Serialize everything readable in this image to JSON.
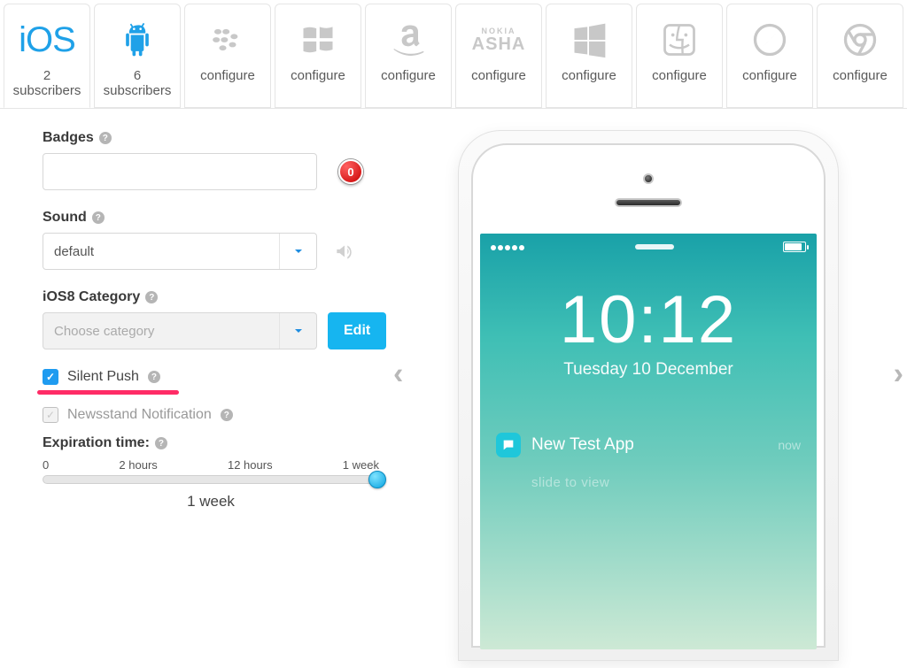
{
  "platforms": [
    {
      "id": "ios",
      "count": "2",
      "count_label": "subscribers"
    },
    {
      "id": "android",
      "count": "6",
      "count_label": "subscribers"
    },
    {
      "id": "blackberry",
      "label": "configure"
    },
    {
      "id": "windows-phone",
      "label": "configure"
    },
    {
      "id": "amazon",
      "label": "configure"
    },
    {
      "id": "nokia-asha",
      "label": "configure"
    },
    {
      "id": "windows",
      "label": "configure"
    },
    {
      "id": "mac",
      "label": "configure"
    },
    {
      "id": "safari",
      "label": "configure"
    },
    {
      "id": "chrome",
      "label": "configure"
    }
  ],
  "form": {
    "badges": {
      "label": "Badges",
      "value": "",
      "counter": "0"
    },
    "sound": {
      "label": "Sound",
      "value": "default"
    },
    "category": {
      "label": "iOS8 Category",
      "placeholder": "Choose category",
      "edit": "Edit"
    },
    "silent_push": {
      "label": "Silent Push",
      "checked": true
    },
    "newsstand": {
      "label": "Newsstand Notification",
      "checked": true,
      "disabled": true
    },
    "expiration": {
      "label": "Expiration time:",
      "ticks": [
        "0",
        "2 hours",
        "12 hours",
        "1 week"
      ],
      "value_label": "1 week"
    }
  },
  "preview": {
    "time": "10:12",
    "date": "Tuesday 10 December",
    "app_name": "New Test App",
    "when": "now",
    "slide": "slide to view"
  }
}
